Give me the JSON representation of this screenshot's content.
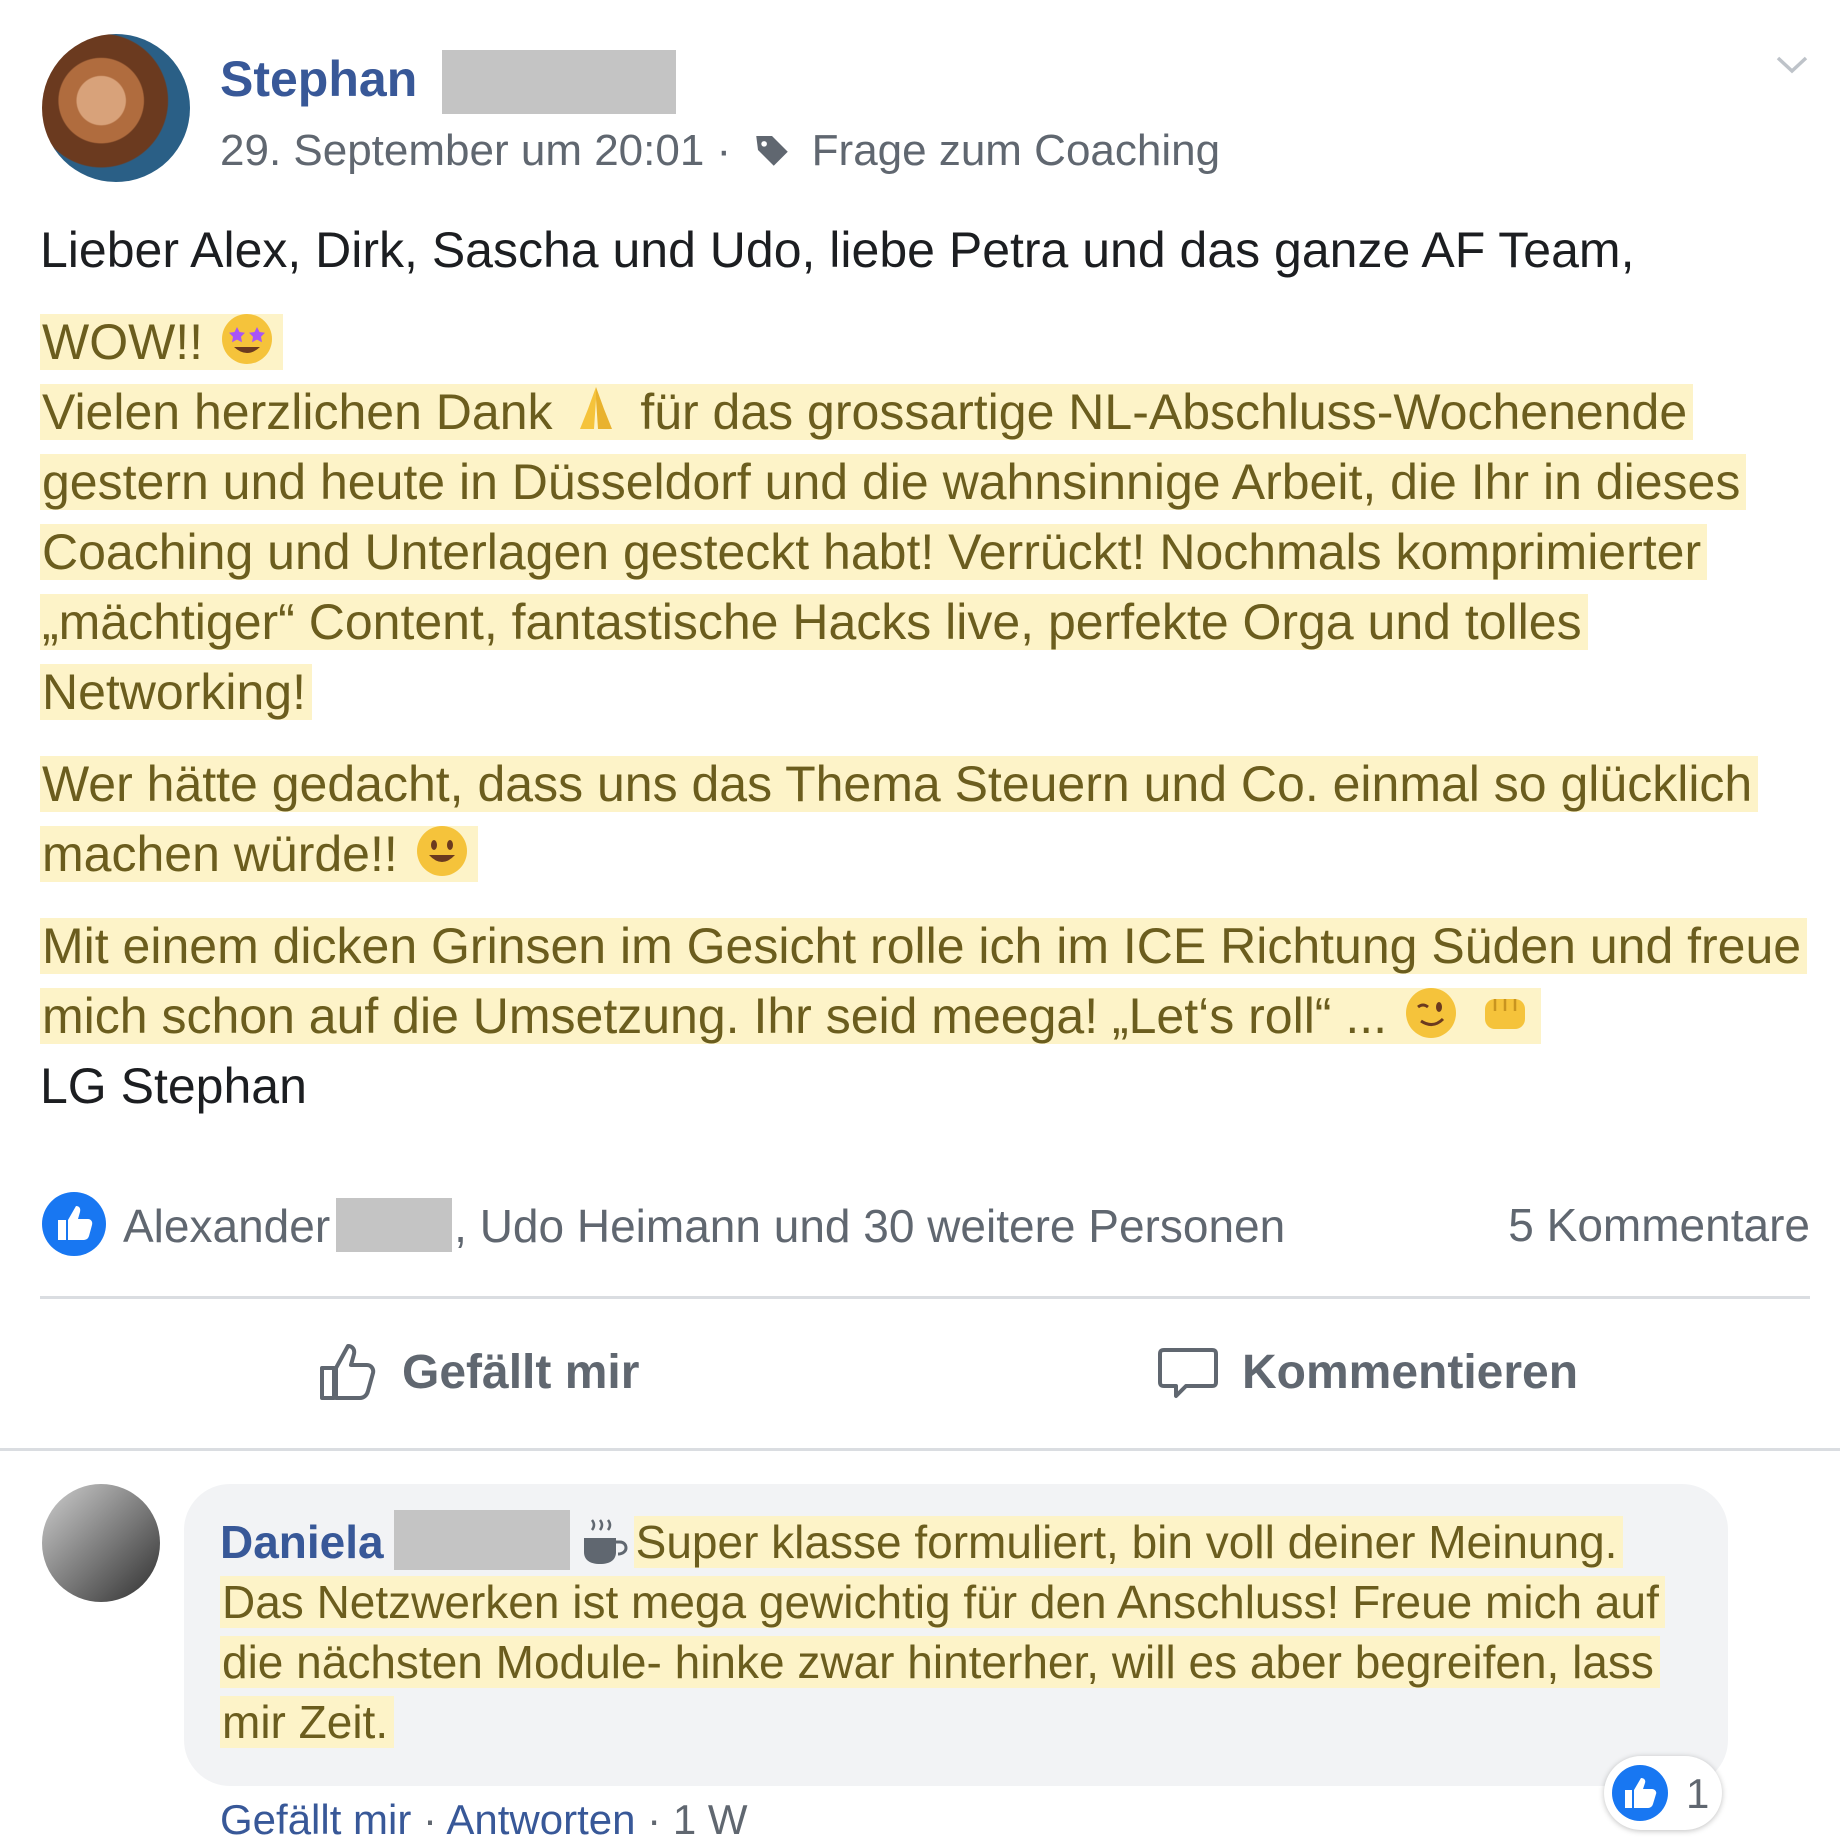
{
  "post": {
    "author_first": "Stephan",
    "timestamp": "29. September um 20:01",
    "separator": "·",
    "tag": "Frage zum Coaching",
    "body": {
      "greeting": "Lieber Alex, Dirk, Sascha und Udo, liebe Petra und das ganze AF Team,",
      "wow": "WOW!!",
      "para1_a": "Vielen herzlichen Dank",
      "para1_b": "für das grossartige NL-Abschluss-Wochenende gestern und heute in Düsseldorf und die wahnsinnige Arbeit, die Ihr in dieses Coaching und Unterlagen gesteckt habt! Verrückt! Nochmals komprimierter „mächtiger“ Content, fantastische Hacks live, perfekte Orga und tolles Networking!",
      "para2": "Wer hätte gedacht, dass uns das Thema Steuern und Co. einmal so glücklich machen würde!!",
      "para3": "Mit einem dicken Grinsen im Gesicht rolle ich im ICE Richtung Süden und freue mich schon auf die Umsetzung. Ihr seid meega! „Let‘s roll“ ...",
      "signature": "LG Stephan"
    },
    "emojis": [
      "star-struck-icon",
      "praying-hands-icon",
      "smiley-icon",
      "wink-icon",
      "fist-bump-icon"
    ]
  },
  "reactions": {
    "first_reactor": "Alexander",
    "rest": ", Udo Heimann und 30 weitere Personen",
    "comments_count": "5 Kommentare"
  },
  "actions": {
    "like_label": "Gefällt mir",
    "comment_label": "Kommentieren"
  },
  "comment": {
    "author_first": "Daniela",
    "text": "Super klasse formuliert, bin voll deiner Meinung. Das Netzwerken ist mega gewichtig für den Anschluss! Freue mich auf die nächsten Module- hinke zwar hinterher, will es aber begreifen, lass mir Zeit.",
    "like_count": "1",
    "footer": {
      "like": "Gefällt mir",
      "sep": "·",
      "reply": "Antworten",
      "time": "1 W"
    }
  },
  "colors": {
    "link_blue": "#385898",
    "highlight": "#fdf3c8",
    "like_blue": "#1877f2",
    "muted": "#606770"
  }
}
